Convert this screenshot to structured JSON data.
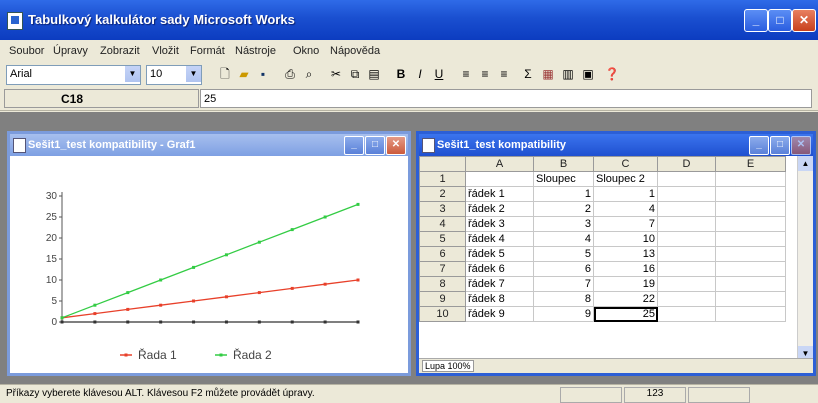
{
  "app": {
    "title": "Tabulkový kalkulátor sady Microsoft Works"
  },
  "menu": [
    "Soubor",
    "Úpravy",
    "Zobrazit",
    "Vložit",
    "Formát",
    "Nástroje",
    "Okno",
    "Nápověda"
  ],
  "toolbar": {
    "font": "Arial",
    "font_size": "10"
  },
  "formula_bar": {
    "cell_ref": "C18",
    "content": "25"
  },
  "chart_window": {
    "title": "Sešit1_test kompatibility - Graf1"
  },
  "sheet_window": {
    "title": "Sešit1_test kompatibility",
    "columns": [
      "",
      "A",
      "B",
      "C",
      "D",
      "E"
    ],
    "rows": [
      {
        "n": "1",
        "a": "",
        "b": "Sloupec",
        "c": "Sloupec 2"
      },
      {
        "n": "2",
        "a": "řádek 1",
        "b": "1",
        "c": "1"
      },
      {
        "n": "3",
        "a": "řádek 2",
        "b": "2",
        "c": "4"
      },
      {
        "n": "4",
        "a": "řádek 3",
        "b": "3",
        "c": "7"
      },
      {
        "n": "5",
        "a": "řádek 4",
        "b": "4",
        "c": "10"
      },
      {
        "n": "6",
        "a": "řádek 5",
        "b": "5",
        "c": "13"
      },
      {
        "n": "7",
        "a": "řádek 6",
        "b": "6",
        "c": "16"
      },
      {
        "n": "8",
        "a": "řádek 7",
        "b": "7",
        "c": "19"
      },
      {
        "n": "9",
        "a": "řádek 8",
        "b": "8",
        "c": "22"
      },
      {
        "n": "10",
        "a": "řádek 9",
        "b": "9",
        "c": "25"
      }
    ],
    "zoom": "Lupa 100%"
  },
  "statusbar": {
    "message": "Příkazy vyberete klávesou ALT. Klávesou F2 můžete provádět úpravy.",
    "value": "123"
  },
  "chart_data": {
    "type": "line",
    "x": [
      1,
      2,
      3,
      4,
      5,
      6,
      7,
      8,
      9,
      10
    ],
    "yticks": [
      "0",
      "5",
      "10",
      "15",
      "20",
      "25",
      "30"
    ],
    "ylim": [
      0,
      30
    ],
    "series": [
      {
        "name": "Řada 1",
        "color": "#e8402a",
        "values": [
          1,
          2,
          3,
          4,
          5,
          6,
          7,
          8,
          9,
          10
        ]
      },
      {
        "name": "Řada 2",
        "color": "#33cc44",
        "values": [
          1,
          4,
          7,
          10,
          13,
          16,
          19,
          22,
          25,
          28
        ]
      },
      {
        "name": "",
        "color": "#333333",
        "values": [
          0,
          0,
          0,
          0,
          0,
          0,
          0,
          0,
          0,
          0
        ]
      }
    ],
    "legend_position": "bottom"
  }
}
